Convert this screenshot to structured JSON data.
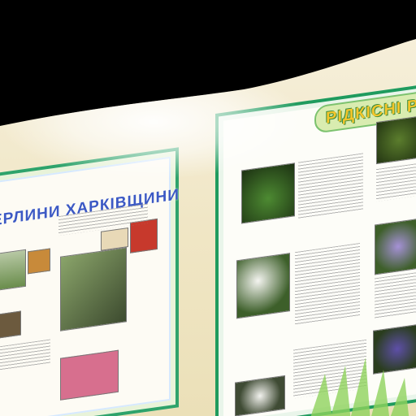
{
  "posters": {
    "left_title": "ЕРЛИНИ ХАРКІВЩИНИ",
    "right_title": "РІДКІСНІ РО"
  },
  "colors": {
    "frame_green": "#1f9b5e",
    "left_title_blue": "#3c59c4",
    "right_title_yellow": "#f3c52b",
    "wall": "#f0e6c5"
  }
}
